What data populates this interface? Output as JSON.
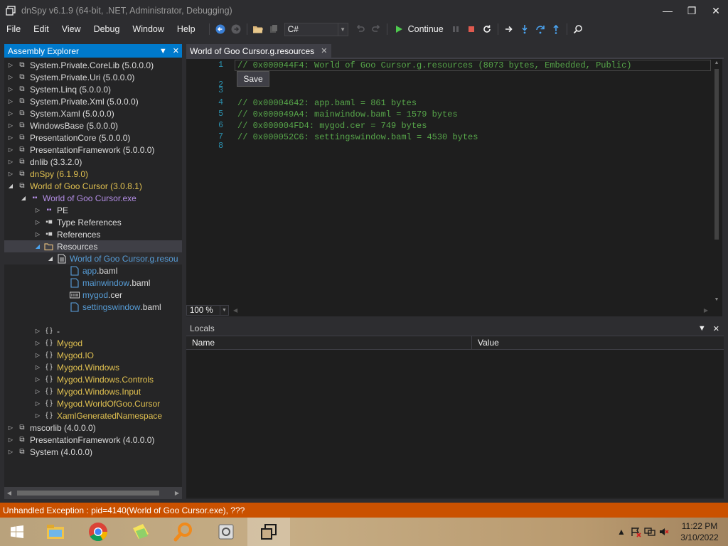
{
  "window": {
    "title": "dnSpy v6.1.9 (64-bit, .NET, Administrator, Debugging)",
    "controls": {
      "minimize": "—",
      "maximize": "❐",
      "close": "✕"
    }
  },
  "menu": [
    "File",
    "Edit",
    "View",
    "Debug",
    "Window",
    "Help"
  ],
  "toolbar": {
    "language": "C#",
    "continue_label": "Continue"
  },
  "explorer": {
    "title": "Assembly Explorer",
    "items": [
      {
        "text": "System.Private.CoreLib (5.0.0.0)",
        "color": "white"
      },
      {
        "text": "System.Private.Uri (5.0.0.0)",
        "color": "white"
      },
      {
        "text": "System.Linq (5.0.0.0)",
        "color": "white"
      },
      {
        "text": "System.Private.Xml (5.0.0.0)",
        "color": "white"
      },
      {
        "text": "System.Xaml (5.0.0.0)",
        "color": "white"
      },
      {
        "text": "WindowsBase (5.0.0.0)",
        "color": "white"
      },
      {
        "text": "PresentationCore (5.0.0.0)",
        "color": "white"
      },
      {
        "text": "PresentationFramework (5.0.0.0)",
        "color": "white"
      },
      {
        "text": "dnlib (3.3.2.0)",
        "color": "white"
      },
      {
        "text": "dnSpy (6.1.9.0)",
        "color": "gold"
      },
      {
        "text": "World of Goo Cursor (3.0.8.1)",
        "color": "gold"
      },
      {
        "text": "World of Goo Cursor.exe",
        "color": "purple"
      },
      {
        "text": "PE",
        "color": "white"
      },
      {
        "text": "Type References",
        "color": "white"
      },
      {
        "text": "References",
        "color": "white"
      },
      {
        "text": "Resources",
        "color": "white"
      },
      {
        "text": "World of Goo Cursor.g.resou",
        "color": "blue"
      },
      {
        "name": "app",
        "ext": ".baml"
      },
      {
        "name": "mainwindow",
        "ext": ".baml"
      },
      {
        "name": "mygod",
        "ext": ".cer"
      },
      {
        "name": "settingswindow",
        "ext": ".baml"
      },
      {
        "text": "-",
        "color": "white"
      },
      {
        "text": "Mygod",
        "color": "gold"
      },
      {
        "text": "Mygod.IO",
        "color": "gold"
      },
      {
        "text": "Mygod.Windows",
        "color": "gold"
      },
      {
        "text": "Mygod.Windows.Controls",
        "color": "gold"
      },
      {
        "text": "Mygod.Windows.Input",
        "color": "gold"
      },
      {
        "text": "Mygod.WorldOfGoo.Cursor",
        "color": "gold"
      },
      {
        "text": "XamlGeneratedNamespace",
        "color": "gold"
      },
      {
        "text": "mscorlib (4.0.0.0)",
        "color": "white"
      },
      {
        "text": "PresentationFramework (4.0.0.0)",
        "color": "white"
      },
      {
        "text": "System (4.0.0.0)",
        "color": "white"
      }
    ]
  },
  "editor": {
    "tab_title": "World of Goo Cursor.g.resources",
    "save_popup": "Save",
    "line_numbers": [
      "1",
      "2",
      "3",
      "4",
      "5",
      "6",
      "7",
      "8"
    ],
    "lines": [
      "// 0x000044F4: World of Goo Cursor.g.resources (8073 bytes, Embedded, Public)",
      "",
      "",
      "// 0x00004642: app.baml = 861 bytes",
      "// 0x000049A4: mainwindow.baml = 1579 bytes",
      "// 0x000004FD4: mygod.cer = 749 bytes",
      "// 0x000052C6: settingswindow.baml = 4530 bytes",
      ""
    ],
    "zoom": "100 %"
  },
  "locals": {
    "title": "Locals",
    "col_name": "Name",
    "col_value": "Value"
  },
  "status": {
    "text": "Unhandled Exception : pid=4140(World of Goo Cursor.exe), ???"
  },
  "taskbar": {
    "time": "11:22 PM",
    "date": "3/10/2022"
  }
}
